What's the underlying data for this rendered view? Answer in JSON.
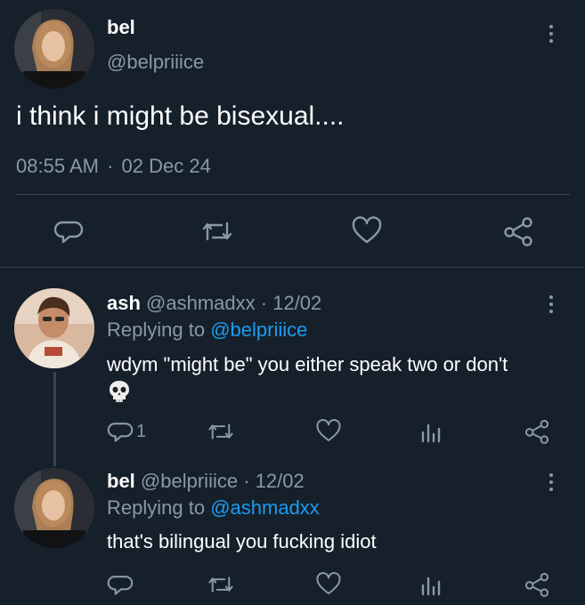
{
  "main_tweet": {
    "name": "bel",
    "handle": "@belpriiice",
    "text": "i think i might be bisexual....",
    "time": "08:55 AM",
    "separator": "·",
    "date": "02 Dec 24",
    "icons": [
      "reply-icon",
      "retweet-icon",
      "like-icon",
      "share-icon"
    ]
  },
  "replies": [
    {
      "name": "ash",
      "handle": "@ashmadxx",
      "date_prefix": "· 12/02",
      "replying_label": "Replying to",
      "replying_handle": "@belpriiice",
      "text": "wdym \"might be\" you either speak two or don't",
      "emoji": "💀",
      "reply_count": "1"
    },
    {
      "name": "bel",
      "handle": "@belpriiice",
      "date_prefix": "· 12/02",
      "replying_label": "Replying to",
      "replying_handle": "@ashmadxx",
      "text": "that's bilingual you fucking idiot",
      "reply_count": ""
    }
  ],
  "colors": {
    "background": "#15202b",
    "muted": "#8b98a5",
    "link": "#1d9bf0",
    "divider": "#38444d"
  }
}
